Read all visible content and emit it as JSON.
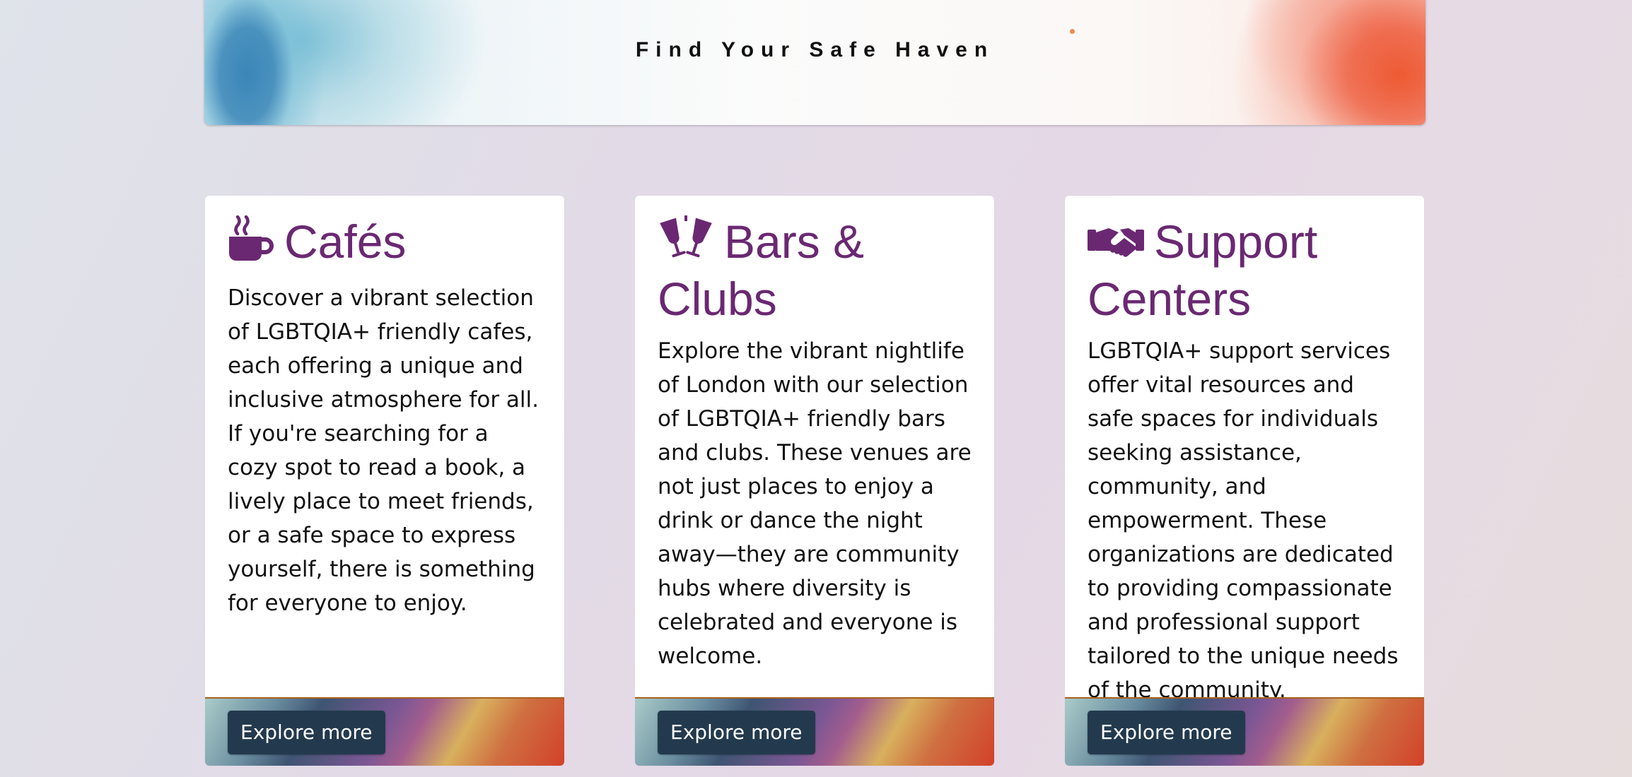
{
  "banner": {
    "title": "Find Your Safe Haven"
  },
  "cards": [
    {
      "icon": "mug-hot-icon",
      "title": "Cafés",
      "text": "Discover a vibrant selection of LGBTQIA+ friendly cafes, each offering a unique and inclusive atmosphere for all. If you're searching for a cozy spot to read a book, a lively place to meet friends, or a safe space to express yourself, there is something for everyone to enjoy.",
      "button": "Explore more"
    },
    {
      "icon": "champagne-glasses-icon",
      "title": "Bars & Clubs",
      "text": "Explore the vibrant nightlife of London with our selection of LGBTQIA+ friendly bars and clubs. These venues are not just places to enjoy a drink or dance the night away—they are community hubs where diversity is celebrated and everyone is welcome.",
      "button": "Explore more"
    },
    {
      "icon": "handshake-icon",
      "title": "Support Centers",
      "text": "LGBTQIA+ support services offer vital resources and safe spaces for individuals seeking assistance, community, and empowerment. These organizations are dedicated to providing compassionate and professional support tailored to the unique needs of the community.",
      "button": "Explore more"
    }
  ],
  "colors": {
    "title": "#6a2872",
    "button": "#233a4e"
  }
}
